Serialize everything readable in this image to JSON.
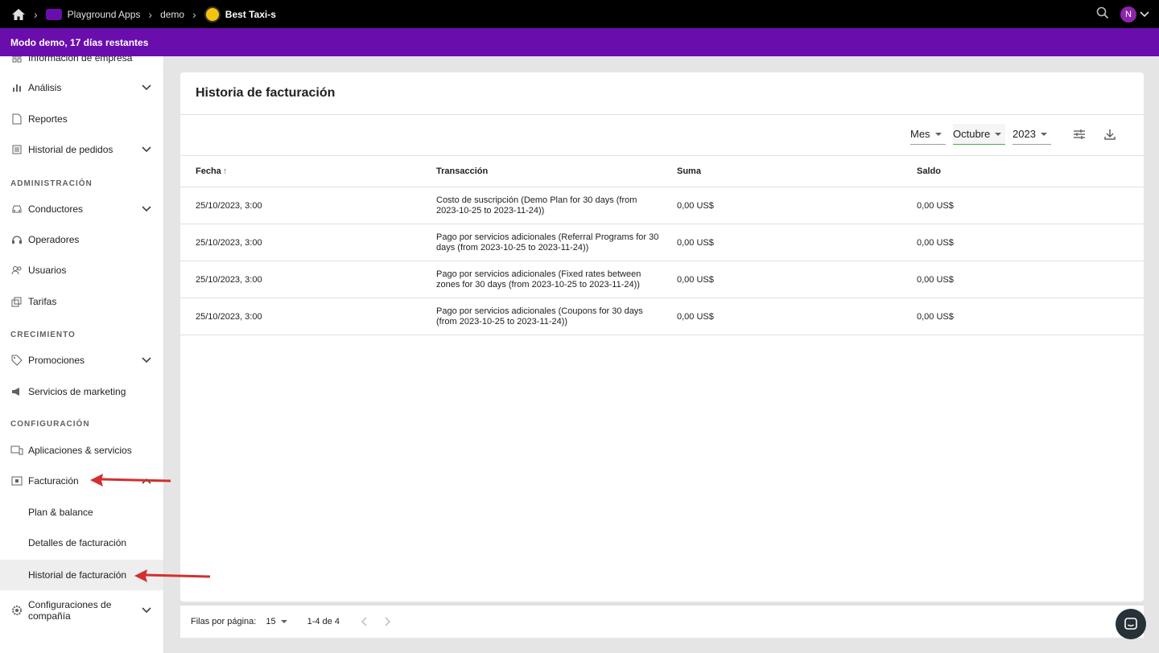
{
  "breadcrumbs": {
    "org": "Playground Apps",
    "env": "demo",
    "app": "Best Taxi-s"
  },
  "user": {
    "initial": "N"
  },
  "banner": {
    "text": "Modo demo, 17 días restantes"
  },
  "sidebar": {
    "items": [
      {
        "label": "Información de empresa"
      },
      {
        "label": "Análisis"
      },
      {
        "label": "Reportes"
      },
      {
        "label": "Historial de pedidos"
      },
      {
        "label": "Conductores"
      },
      {
        "label": "Operadores"
      },
      {
        "label": "Usuarios"
      },
      {
        "label": "Tarifas"
      },
      {
        "label": "Promociones"
      },
      {
        "label": "Servicios de marketing"
      },
      {
        "label": "Aplicaciones & servicios"
      },
      {
        "label": "Facturación"
      },
      {
        "label": "Configuraciones de compañía"
      }
    ],
    "sections": {
      "admin": "ADMINISTRACIÓN",
      "growth": "CRECIMIENTO",
      "config": "CONFIGURACIÓN"
    },
    "billing_sub": {
      "plan": "Plan & balance",
      "details": "Detalles de facturación",
      "history": "Historial de facturación"
    }
  },
  "page": {
    "title": "Historia de facturación",
    "filters": {
      "period": "Mes",
      "month": "Octubre",
      "year": "2023"
    },
    "table": {
      "headers": {
        "date": "Fecha",
        "transaction": "Transacción",
        "amount": "Suma",
        "balance": "Saldo"
      },
      "rows": [
        {
          "date": "25/10/2023, 3:00",
          "transaction": "Costo de suscripción (Demo Plan for 30 days (from 2023-10-25 to 2023-11-24))",
          "amount": "0,00 US$",
          "balance": "0,00 US$"
        },
        {
          "date": "25/10/2023, 3:00",
          "transaction": "Pago por servicios adicionales (Referral Programs for 30 days (from 2023-10-25 to 2023-11-24))",
          "amount": "0,00 US$",
          "balance": "0,00 US$"
        },
        {
          "date": "25/10/2023, 3:00",
          "transaction": "Pago por servicios adicionales (Fixed rates between zones for 30 days (from 2023-10-25 to 2023-11-24))",
          "amount": "0,00 US$",
          "balance": "0,00 US$"
        },
        {
          "date": "25/10/2023, 3:00",
          "transaction": "Pago por servicios adicionales (Coupons for 30 days (from 2023-10-25 to 2023-11-24))",
          "amount": "0,00 US$",
          "balance": "0,00 US$"
        }
      ]
    },
    "pagination": {
      "rows_label": "Filas por página:",
      "rows_value": "15",
      "range": "1-4 de 4"
    }
  },
  "colors": {
    "banner": "#6a0dad",
    "annotation_arrow": "#d32f2f"
  }
}
